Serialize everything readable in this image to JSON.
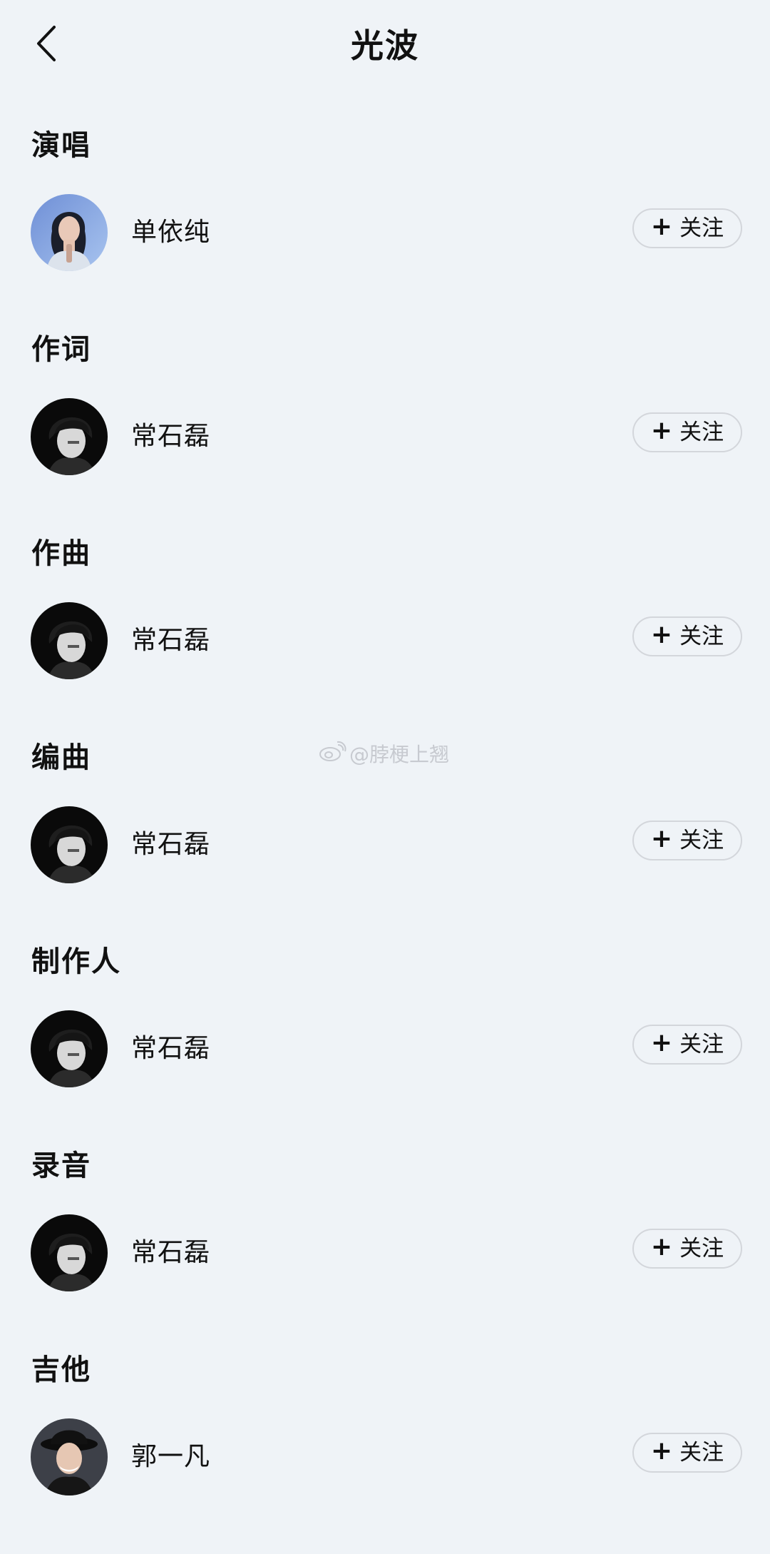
{
  "header": {
    "title": "光波"
  },
  "follow_label": "关注",
  "follow_plus": "+",
  "sections": [
    {
      "role": "演唱",
      "name": "单依纯",
      "avatar": "avatar-female-singer"
    },
    {
      "role": "作词",
      "name": "常石磊",
      "avatar": "avatar-male-bw"
    },
    {
      "role": "作曲",
      "name": "常石磊",
      "avatar": "avatar-male-bw"
    },
    {
      "role": "编曲",
      "name": "常石磊",
      "avatar": "avatar-male-bw"
    },
    {
      "role": "制作人",
      "name": "常石磊",
      "avatar": "avatar-male-bw"
    },
    {
      "role": "录音",
      "name": "常石磊",
      "avatar": "avatar-male-bw"
    },
    {
      "role": "吉他",
      "name": "郭一凡",
      "avatar": "avatar-male-hat"
    }
  ],
  "watermark": {
    "text": "@脖梗上翘",
    "icon": "weibo-icon"
  },
  "colors": {
    "background": "#eff3f7",
    "text": "#111111",
    "button_border": "#d3d6db",
    "watermark": "#c7cad0"
  }
}
